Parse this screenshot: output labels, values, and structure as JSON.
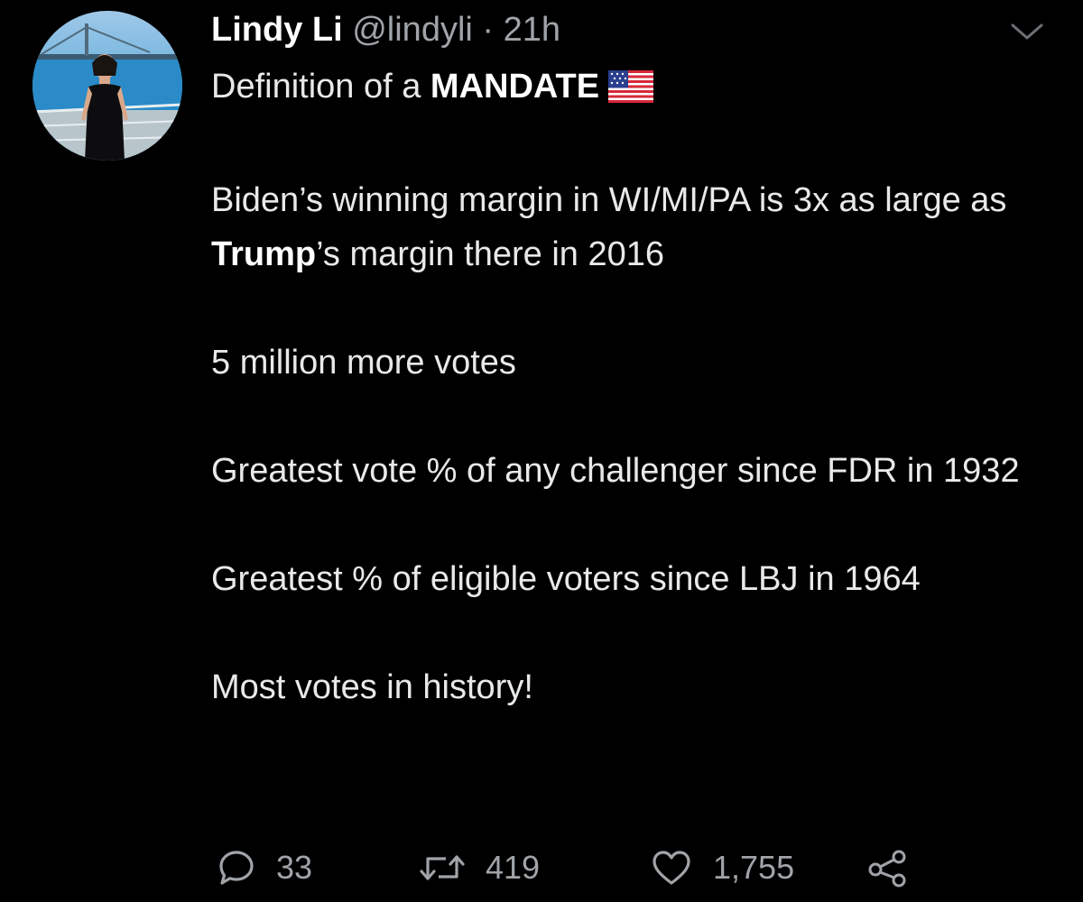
{
  "tweet": {
    "author": {
      "name": "Lindy Li",
      "handle": "@lindyli",
      "separator": "·",
      "time": "21h"
    },
    "lines": [
      {
        "parts": [
          {
            "text": "Definition of a ",
            "bold": false
          },
          {
            "text": "MANDATE",
            "bold": true
          }
        ],
        "emoji": "us-flag"
      },
      {
        "parts": [
          {
            "text": "Biden’s winning margin in WI/MI/PA is 3x as large as ",
            "bold": false
          },
          {
            "text": "Trump",
            "bold": true
          },
          {
            "text": "’s margin there in 2016",
            "bold": false
          }
        ]
      },
      {
        "parts": [
          {
            "text": "5 million more votes",
            "bold": false
          }
        ]
      },
      {
        "parts": [
          {
            "text": "Greatest vote % of any challenger since FDR in 1932",
            "bold": false
          }
        ]
      },
      {
        "parts": [
          {
            "text": "Greatest % of eligible voters since LBJ in 1964",
            "bold": false
          }
        ]
      },
      {
        "parts": [
          {
            "text": "Most votes in history!",
            "bold": false
          }
        ]
      }
    ],
    "actions": {
      "reply": {
        "icon": "reply-icon",
        "count": "33"
      },
      "retweet": {
        "icon": "retweet-icon",
        "count": "419"
      },
      "like": {
        "icon": "heart-icon",
        "count": "1,755"
      },
      "share": {
        "icon": "share-icon"
      }
    },
    "menu_icon": "chevron-down-icon"
  },
  "colors": {
    "background": "#000000",
    "text": "#e7e9ea",
    "muted": "#a0a4a8"
  }
}
